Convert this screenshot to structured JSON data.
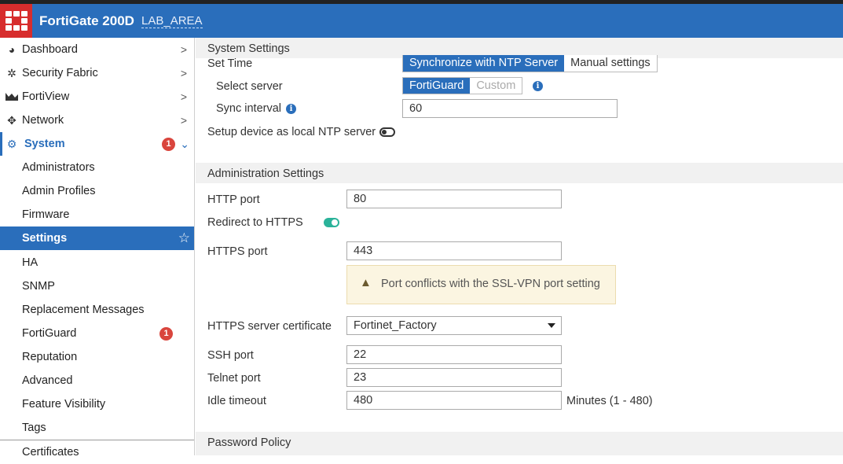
{
  "header": {
    "device_name": "FortiGate 200D",
    "vdom": "LAB_AREA",
    "logo_icon": "fortinet-logo-icon",
    "brand_color": "#2a6ebb",
    "logo_color": "#d72d2d"
  },
  "sidebar": {
    "items": [
      {
        "label": "Dashboard",
        "icon": "dashboard-icon"
      },
      {
        "label": "Security Fabric",
        "icon": "security-fabric-icon"
      },
      {
        "label": "FortiView",
        "icon": "fortiview-icon"
      },
      {
        "label": "Network",
        "icon": "network-icon"
      },
      {
        "label": "System",
        "icon": "gear-icon",
        "badge": "1"
      }
    ],
    "subitems": [
      {
        "label": "Administrators"
      },
      {
        "label": "Admin Profiles"
      },
      {
        "label": "Firmware"
      },
      {
        "label": "Settings"
      },
      {
        "label": "HA"
      },
      {
        "label": "SNMP"
      },
      {
        "label": "Replacement Messages"
      },
      {
        "label": "FortiGuard",
        "badge": "1"
      },
      {
        "label": "Reputation"
      },
      {
        "label": "Advanced"
      },
      {
        "label": "Feature Visibility"
      },
      {
        "label": "Tags"
      },
      {
        "label": "Certificates"
      }
    ]
  },
  "system_settings": {
    "header": "System Settings",
    "set_time_label": "Set Time",
    "set_time_options": [
      "Synchronize with NTP Server",
      "Manual settings"
    ],
    "select_server_label": "Select server",
    "server_options": [
      "FortiGuard",
      "Custom"
    ],
    "sync_interval_label": "Sync interval",
    "sync_interval_value": "60",
    "local_ntp_label": "Setup device as local NTP server"
  },
  "admin_settings": {
    "header": "Administration Settings",
    "http_port_label": "HTTP port",
    "http_port_value": "80",
    "redirect_label": "Redirect to HTTPS",
    "https_port_label": "HTTPS port",
    "https_port_value": "443",
    "warning_text": "Port conflicts with the SSL-VPN port setting",
    "cert_label": "HTTPS server certificate",
    "cert_value": "Fortinet_Factory",
    "ssh_port_label": "SSH port",
    "ssh_port_value": "22",
    "telnet_port_label": "Telnet port",
    "telnet_port_value": "23",
    "idle_timeout_label": "Idle timeout",
    "idle_timeout_value": "480",
    "idle_timeout_unit": "Minutes (1 - 480)"
  },
  "password_policy": {
    "header": "Password Policy"
  }
}
